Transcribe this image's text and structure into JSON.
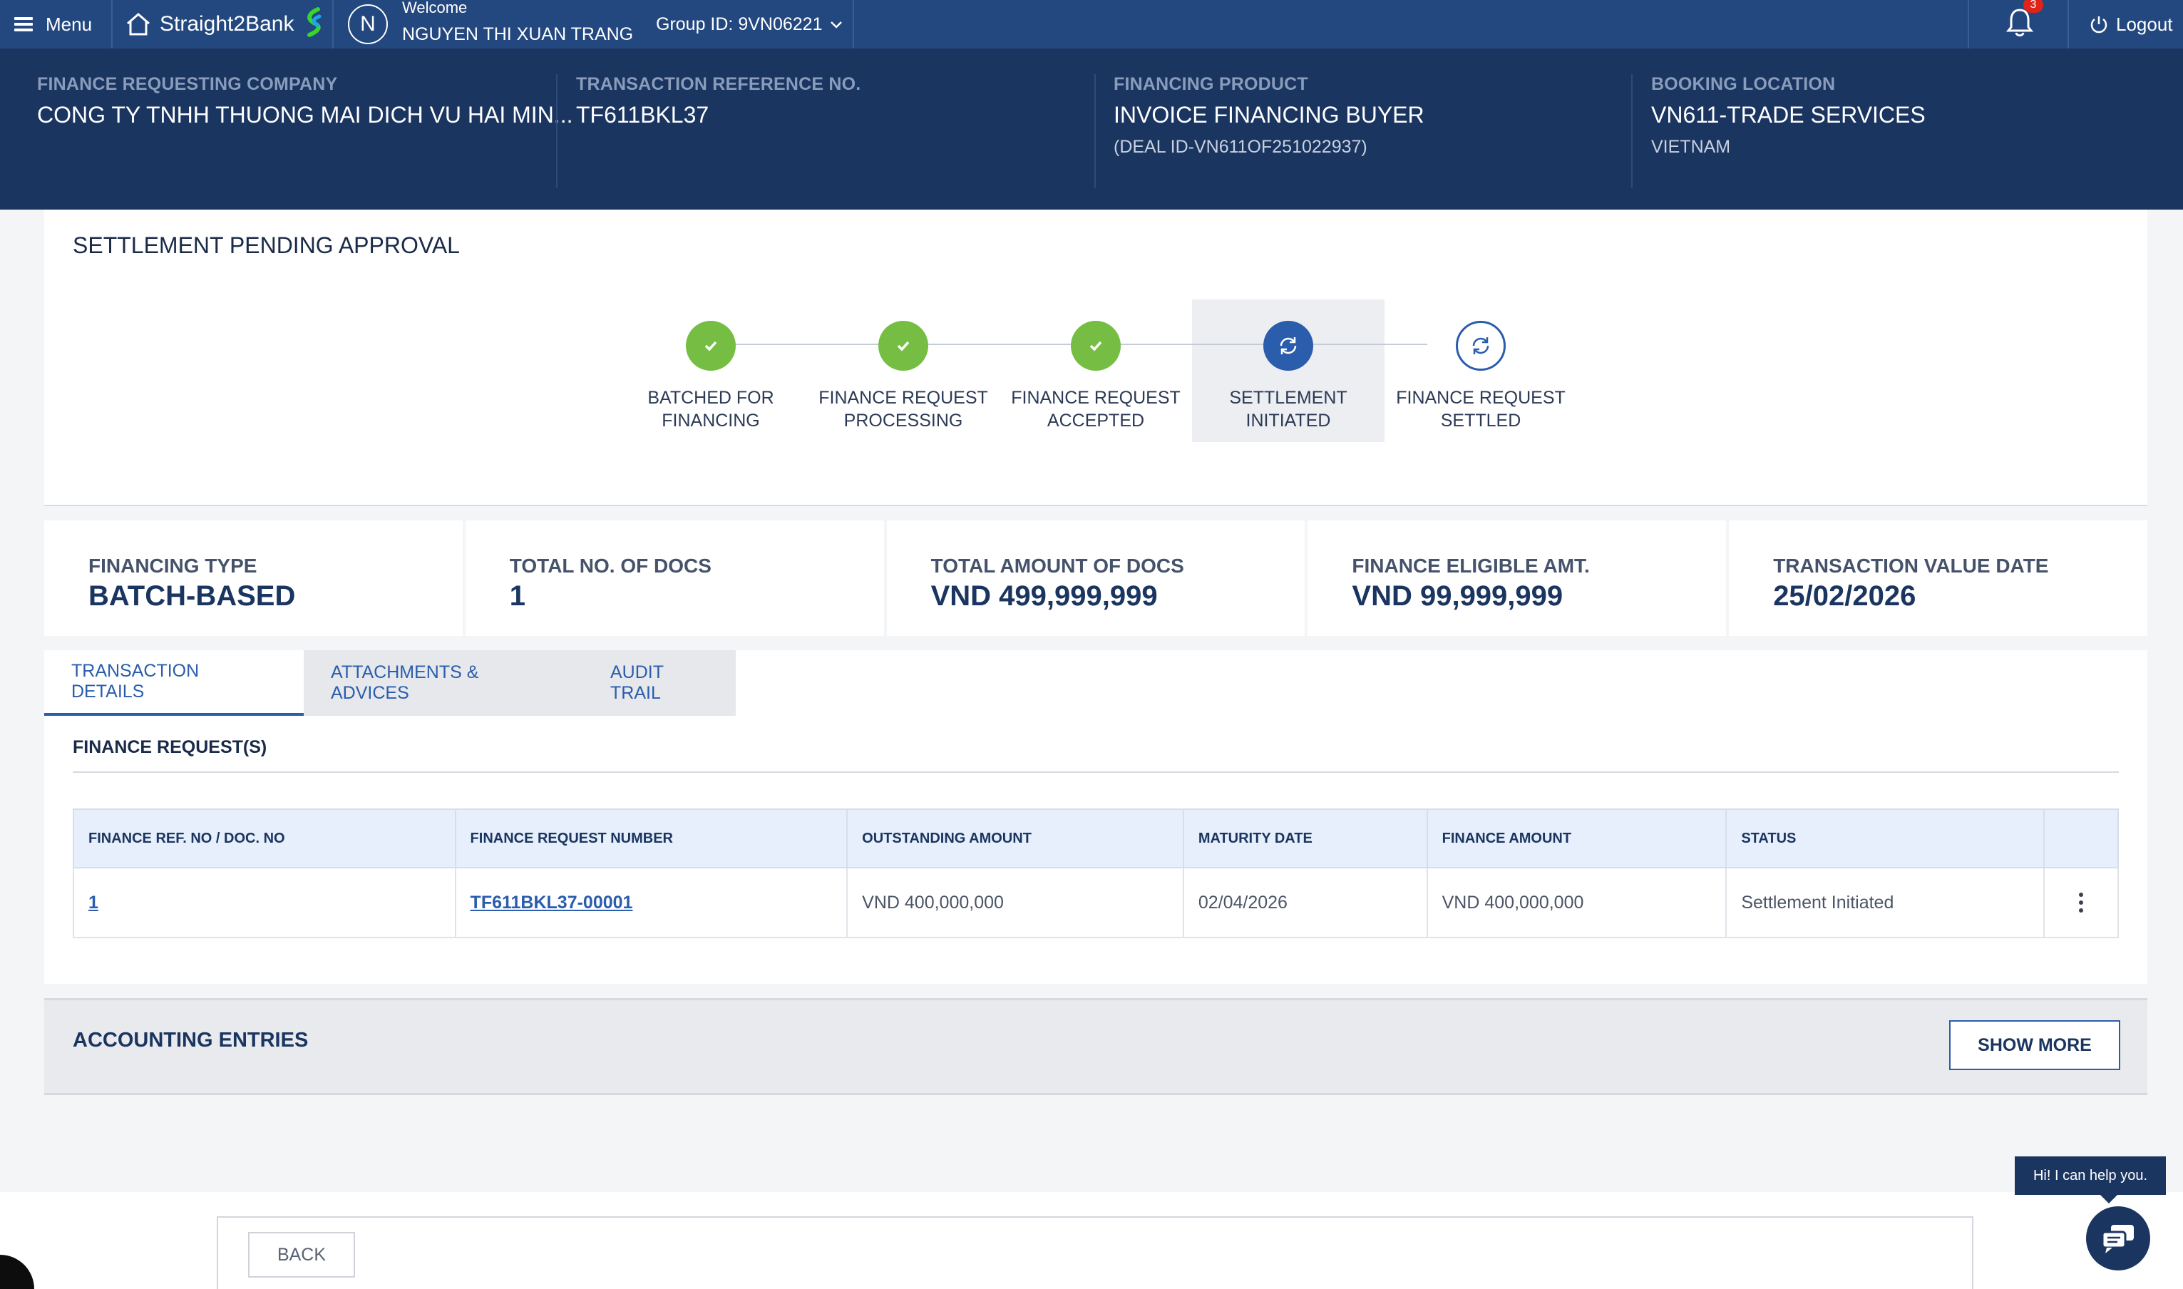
{
  "topnav": {
    "menu_label": "Menu",
    "brand_name": "Straight2Bank",
    "avatar_initial": "N",
    "welcome_label": "Welcome",
    "user_name": "NGUYEN THI XUAN TRANG",
    "group_label": "Group ID: 9VN06221",
    "notification_count": "3",
    "logout_label": "Logout"
  },
  "header": {
    "company_label": "FINANCE REQUESTING COMPANY",
    "company_value": "CONG TY TNHH THUONG MAI DICH VU HAI MIN...",
    "ref_label": "TRANSACTION REFERENCE NO.",
    "ref_value": "TF611BKL37",
    "product_label": "FINANCING PRODUCT",
    "product_value": "INVOICE FINANCING BUYER",
    "product_sub": "(DEAL ID-VN611OF251022937)",
    "location_label": "BOOKING LOCATION",
    "location_value": "VN611-TRADE SERVICES",
    "location_sub": "VIETNAM"
  },
  "progress": {
    "title": "SETTLEMENT PENDING APPROVAL",
    "steps": [
      {
        "line1": "BATCHED FOR",
        "line2": "FINANCING",
        "state": "done"
      },
      {
        "line1": "FINANCE REQUEST",
        "line2": "PROCESSING",
        "state": "done"
      },
      {
        "line1": "FINANCE REQUEST",
        "line2": "ACCEPTED",
        "state": "done"
      },
      {
        "line1": "SETTLEMENT",
        "line2": "INITIATED",
        "state": "active"
      },
      {
        "line1": "FINANCE REQUEST",
        "line2": "SETTLED",
        "state": "pending"
      }
    ]
  },
  "summary": {
    "items": [
      {
        "label": "FINANCING TYPE",
        "value": "BATCH-BASED"
      },
      {
        "label": "TOTAL NO. OF DOCS",
        "value": "1"
      },
      {
        "label": "TOTAL AMOUNT OF DOCS",
        "value": "VND 499,999,999"
      },
      {
        "label": "FINANCE ELIGIBLE AMT.",
        "value": "VND 99,999,999"
      },
      {
        "label": "TRANSACTION VALUE DATE",
        "value": "25/02/2026"
      }
    ]
  },
  "tabs": [
    {
      "label": "TRANSACTION DETAILS"
    },
    {
      "label": "ATTACHMENTS & ADVICES"
    },
    {
      "label": "AUDIT TRAIL"
    }
  ],
  "finance_requests": {
    "title": "FINANCE REQUEST(S)",
    "columns": [
      "FINANCE REF. NO / DOC. NO",
      "FINANCE REQUEST NUMBER",
      "OUTSTANDING AMOUNT",
      "MATURITY DATE",
      "FINANCE AMOUNT",
      "STATUS"
    ],
    "rows": [
      {
        "ref": "1",
        "number": "TF611BKL37-00001",
        "outstanding": "VND 400,000,000",
        "maturity": "02/04/2026",
        "amount": "VND 400,000,000",
        "status": "Settlement Initiated"
      }
    ]
  },
  "accounting": {
    "title": "ACCOUNTING ENTRIES",
    "show_more_label": "SHOW MORE"
  },
  "footer": {
    "back_label": "BACK"
  },
  "chat": {
    "tooltip": "Hi! I can help you."
  },
  "colors": {
    "nav": "#23477f",
    "header": "#1b3561",
    "accent": "#2a5dac",
    "done": "#76be43"
  }
}
